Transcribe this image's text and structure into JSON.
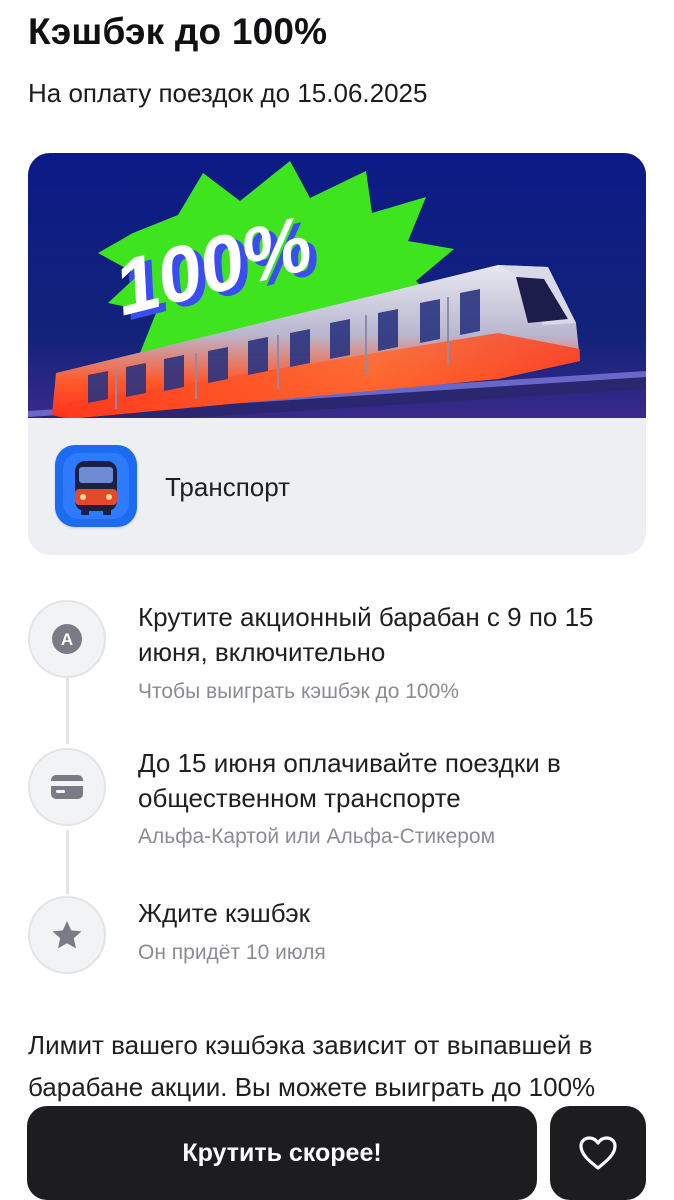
{
  "header": {
    "title": "Кэшбэк до 100%",
    "subtitle": "На оплату поездок до 15.06.2025"
  },
  "promo_card": {
    "banner_text": "100%",
    "category_label": "Транспорт",
    "category_icon": "train-icon"
  },
  "steps": [
    {
      "icon": "letter-a-icon",
      "icon_text": "A",
      "title_lines": [
        "Крутите акционный барабан с 9 по 15",
        "июня, включительно"
      ],
      "subtitle": "Чтобы выиграть кэшбэк до 100%"
    },
    {
      "icon": "card-icon",
      "title_lines": [
        "До 15 июня оплачивайте поездки в",
        "общественном транспорте"
      ],
      "subtitle": "Альфа-Картой или Альфа-Стикером"
    },
    {
      "icon": "star-icon",
      "title_lines": [
        "Ждите кэшбэк"
      ],
      "subtitle": "Он придёт 10 июля"
    }
  ],
  "limit_lines": [
    "Лимит вашего кэшбэка зависит от выпавшей в",
    "барабане акции. Вы можете выиграть до 100%"
  ],
  "actions": {
    "spin_label": "Крутить скорее!",
    "favorite_icon": "heart-icon"
  },
  "colors": {
    "accent_green": "#3ee51f",
    "banner_blue": "#0d1a8a",
    "button_dark": "#1d1d20"
  }
}
